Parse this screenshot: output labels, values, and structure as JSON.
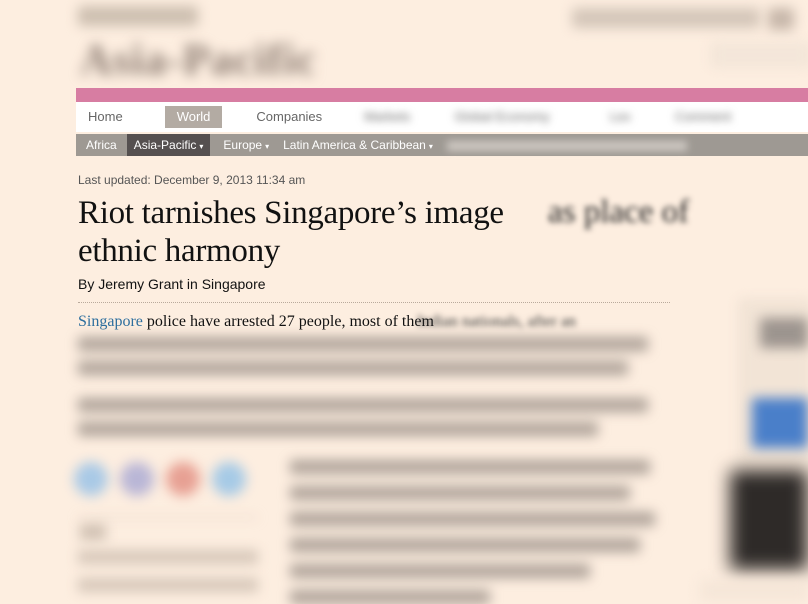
{
  "masthead": {
    "section_title": "Asia-Pacific"
  },
  "primary_nav": {
    "items": [
      "Home",
      "World",
      "Companies",
      "Markets",
      "Global Economy",
      "Lex",
      "Comment"
    ],
    "active": "World"
  },
  "secondary_nav": {
    "items": [
      "Africa",
      "Asia-Pacific",
      "Europe",
      "Latin America & Caribbean"
    ],
    "active": "Asia-Pacific"
  },
  "article": {
    "last_updated": "Last updated: December 9, 2013 11:34 am",
    "headline": "Riot tarnishes Singapore’s image",
    "headline_cont": "ethnic harmony",
    "headline_blur": "as place of",
    "byline": "By Jeremy Grant in Singapore",
    "lede_link": "Singapore",
    "lede_visible": " police have arrested 27 people, most of them",
    "lede_blur": "Indian nationals, after an"
  },
  "colors": {
    "background": "#fdeee0",
    "pink_rule": "#d77da2",
    "link": "#2e6f9e",
    "secondary_nav_bg": "#9e9993",
    "secondary_nav_active": "#555050"
  },
  "icons": [
    "twitter-icon",
    "facebook-icon",
    "google-plus-icon",
    "linkedin-icon"
  ]
}
